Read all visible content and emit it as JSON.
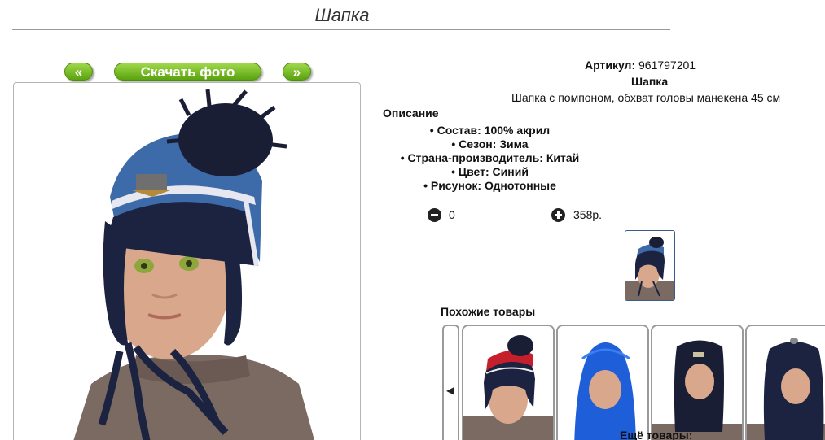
{
  "header": {
    "title": "Шапка"
  },
  "photo_controls": {
    "prev_label": "«",
    "download_label": "Скачать фото",
    "next_label": "»"
  },
  "product": {
    "article_label": "Артикул:",
    "article_value": "961797201",
    "name": "Шапка",
    "short_description": "Шапка с помпоном, обхват головы манекена 45 см",
    "description_heading": "Описание",
    "specs": [
      "Состав: 100% акрил",
      "Сезон: Зима",
      "Страна-производитель: Китай",
      "Цвет: Синий",
      "Рисунок: Однотонные"
    ]
  },
  "purchase": {
    "quantity": "0",
    "price": "358р."
  },
  "similar": {
    "heading": "Похожие товары",
    "prev_icon": "skip-back-icon",
    "items_count": 4
  },
  "more": {
    "heading": "Ещё товары:"
  },
  "colors": {
    "button_green": "#6bb21a",
    "hat_blue": "#3d6aa8",
    "hat_navy": "#1c2340",
    "thumb_border": "#3a5a8a"
  }
}
